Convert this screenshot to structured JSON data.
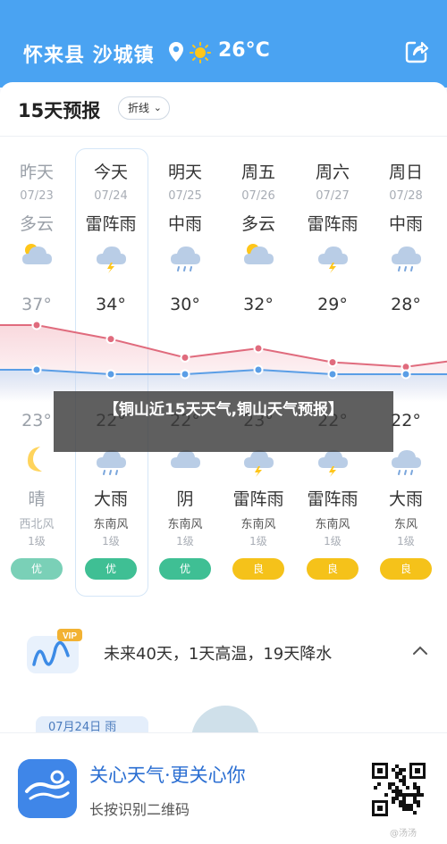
{
  "header": {
    "location": "怀来县 沙城镇",
    "current_temp": "26°C",
    "pin_icon": "location-pin-icon",
    "weather_icon": "sun-icon",
    "share_icon": "share-edit-icon"
  },
  "forecast": {
    "title": "15天预报",
    "view_toggle": "折线",
    "days": [
      {
        "name": "昨天",
        "date": "07/23",
        "cond_day": "多云",
        "high": "37°",
        "low": "23°",
        "cond_night": "晴",
        "wind_dir": "西北风",
        "wind_level": "1级",
        "aqi": "优",
        "aqi_color": "#7ad0b7",
        "icon_day": "partly-cloudy",
        "icon_night": "moon",
        "past": true
      },
      {
        "name": "今天",
        "date": "07/24",
        "cond_day": "雷阵雨",
        "high": "34°",
        "low": "22°",
        "cond_night": "大雨",
        "wind_dir": "东南风",
        "wind_level": "1级",
        "aqi": "优",
        "aqi_color": "#3fbf94",
        "icon_day": "thunder",
        "icon_night": "rain",
        "past": false
      },
      {
        "name": "明天",
        "date": "07/25",
        "cond_day": "中雨",
        "high": "30°",
        "low": "22°",
        "cond_night": "阴",
        "wind_dir": "东南风",
        "wind_level": "1级",
        "aqi": "优",
        "aqi_color": "#3fbf94",
        "icon_day": "rain",
        "icon_night": "cloud",
        "past": false
      },
      {
        "name": "周五",
        "date": "07/26",
        "cond_day": "多云",
        "high": "32°",
        "low": "23°",
        "cond_night": "雷阵雨",
        "wind_dir": "东南风",
        "wind_level": "1级",
        "aqi": "良",
        "aqi_color": "#f5c21a",
        "icon_day": "partly-cloudy",
        "icon_night": "thunder",
        "past": false
      },
      {
        "name": "周六",
        "date": "07/27",
        "cond_day": "雷阵雨",
        "high": "29°",
        "low": "22°",
        "cond_night": "雷阵雨",
        "wind_dir": "东南风",
        "wind_level": "1级",
        "aqi": "良",
        "aqi_color": "#f5c21a",
        "icon_day": "thunder",
        "icon_night": "thunder",
        "past": false
      },
      {
        "name": "周日",
        "date": "07/28",
        "cond_day": "中雨",
        "high": "28°",
        "low": "22°",
        "cond_night": "大雨",
        "wind_dir": "东风",
        "wind_level": "1级",
        "aqi": "良",
        "aqi_color": "#f5c21a",
        "icon_day": "rain",
        "icon_night": "rain",
        "past": false
      }
    ]
  },
  "overlay": {
    "text": "【铜山近15天天气,铜山天气预报】"
  },
  "summary": {
    "badge": "VIP",
    "text": "未来40天，1天高温，19天降水"
  },
  "lower": {
    "date_tag": "07月24日 雨"
  },
  "promo": {
    "title": "关心天气·更关心你",
    "subtitle": "长按识别二维码",
    "watermark": "@汤汤"
  },
  "colors": {
    "header_bg": "#4aa3f2",
    "high_line": "#e06b7d",
    "low_line": "#5a9ee6",
    "aqi_good": "#3fbf94",
    "aqi_fair": "#f5c21a"
  }
}
